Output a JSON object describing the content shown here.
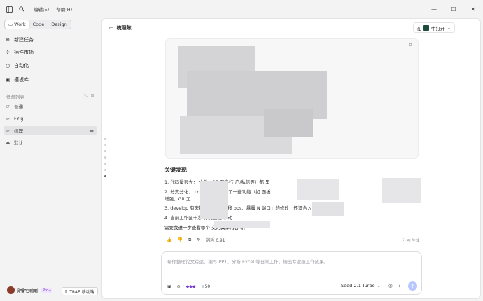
{
  "menu": [
    "编辑(E)",
    "帮助(H)"
  ],
  "sidebar": {
    "modes": [
      "Work",
      "Code",
      "Design"
    ],
    "nav": [
      {
        "icon": "plus-circle-icon",
        "label": "新建任务"
      },
      {
        "icon": "puzzle-icon",
        "label": "插件市场"
      },
      {
        "icon": "clock-icon",
        "label": "自动化"
      },
      {
        "icon": "template-icon",
        "label": "模板库"
      }
    ],
    "tasks_header": "任务列表",
    "tasks": [
      {
        "label": "普通",
        "active": false
      },
      {
        "label": "FY-g",
        "active": false
      },
      {
        "label": "梳理",
        "active": true
      },
      {
        "label": "默认",
        "active": false
      }
    ],
    "user": {
      "name": "肥肥3鸭鸭",
      "badge": "Pro+"
    },
    "trae_button": "TRAE 移动端"
  },
  "header": {
    "title": "梳理陈",
    "open_prefix": "在",
    "open_label": "中打开"
  },
  "content": {
    "heading": "关键发现",
    "items": [
      "1. 代码量很大：                文件。17 万多行                户/私信等）都             里",
      "2. 分支分化：                        Lop 走了不同方                      了一些功能（如            面板",
      "   增强、Git 工",
      "3. develop 有未提交                   埋存了「移                 ops、暴露 N           端口」的修改，还没合入",
      "4. 当前工作区干净                        分支上没有            动"
    ],
    "question": "需要我进一步查看哪个                            交的具体内容吗？",
    "stats": "消耗  0.91",
    "ai_note": "AI 生成"
  },
  "composer": {
    "placeholder": "帮你整理论文综述、编写 PPT、分析 Excel 等日常工作，输出专业级工作成果。",
    "plus_count": "+50",
    "model": "Seed-2.1-Turbo"
  }
}
